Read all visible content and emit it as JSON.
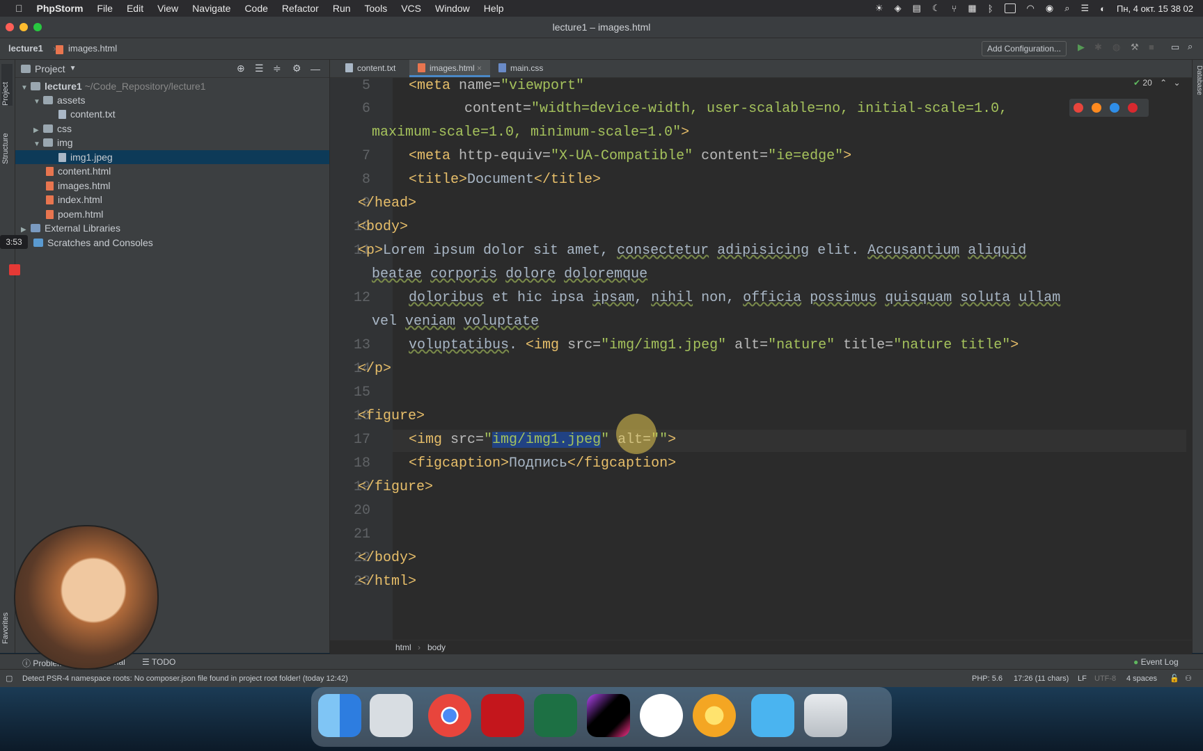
{
  "menubar": {
    "app": "PhpStorm",
    "items": [
      "File",
      "Edit",
      "View",
      "Navigate",
      "Code",
      "Refactor",
      "Run",
      "Tools",
      "VCS",
      "Window",
      "Help"
    ],
    "clock": "Пн, 4 окт.  15 38 02"
  },
  "window": {
    "title": "lecture1 – images.html"
  },
  "nav": {
    "breadcrumb_project": "lecture1",
    "breadcrumb_file": "images.html",
    "run_config": "Add Configuration..."
  },
  "project_panel": {
    "title": "Project",
    "tree": [
      {
        "label": "lecture1",
        "path": "~/Code_Repository/lecture1"
      },
      {
        "label": "assets"
      },
      {
        "label": "content.txt"
      },
      {
        "label": "css"
      },
      {
        "label": "img"
      },
      {
        "label": "img1.jpeg"
      },
      {
        "label": "content.html"
      },
      {
        "label": "images.html"
      },
      {
        "label": "index.html"
      },
      {
        "label": "poem.html"
      },
      {
        "label": "External Libraries"
      },
      {
        "label": "Scratches and Consoles"
      }
    ]
  },
  "left_strip": {
    "project": "Project",
    "structure": "Structure",
    "favorites": "Favorites"
  },
  "right_strip": {
    "database": "Database"
  },
  "tabs": [
    "content.txt",
    "images.html",
    "main.css"
  ],
  "editor": {
    "inspection_count": "20",
    "lines": [
      "5",
      "6",
      "7",
      "8",
      "9",
      "10",
      "11",
      "12",
      "13",
      "14",
      "15",
      "16",
      "17",
      "18",
      "19",
      "20",
      "21",
      "22",
      "23"
    ]
  },
  "breadcrumb_bottom": {
    "a": "html",
    "b": "body"
  },
  "toolwindows": {
    "problems": "Problems",
    "terminal": "Terminal",
    "todo": "TODO",
    "event_log": "Event Log"
  },
  "status": {
    "message": "Detect PSR-4 namespace roots: No composer.json file found in project root folder! (today 12:42)",
    "php": "PHP: 5.6",
    "position": "17:26 (11 chars)",
    "line_sep": "LF",
    "encoding": "UTF-8",
    "indent": "4 spaces"
  },
  "overlay": {
    "timer": "3:53"
  },
  "colors": {
    "accent": "#4a88c7",
    "tag": "#e8bf6a",
    "string": "#a5c25c",
    "bg": "#2b2b2b"
  }
}
